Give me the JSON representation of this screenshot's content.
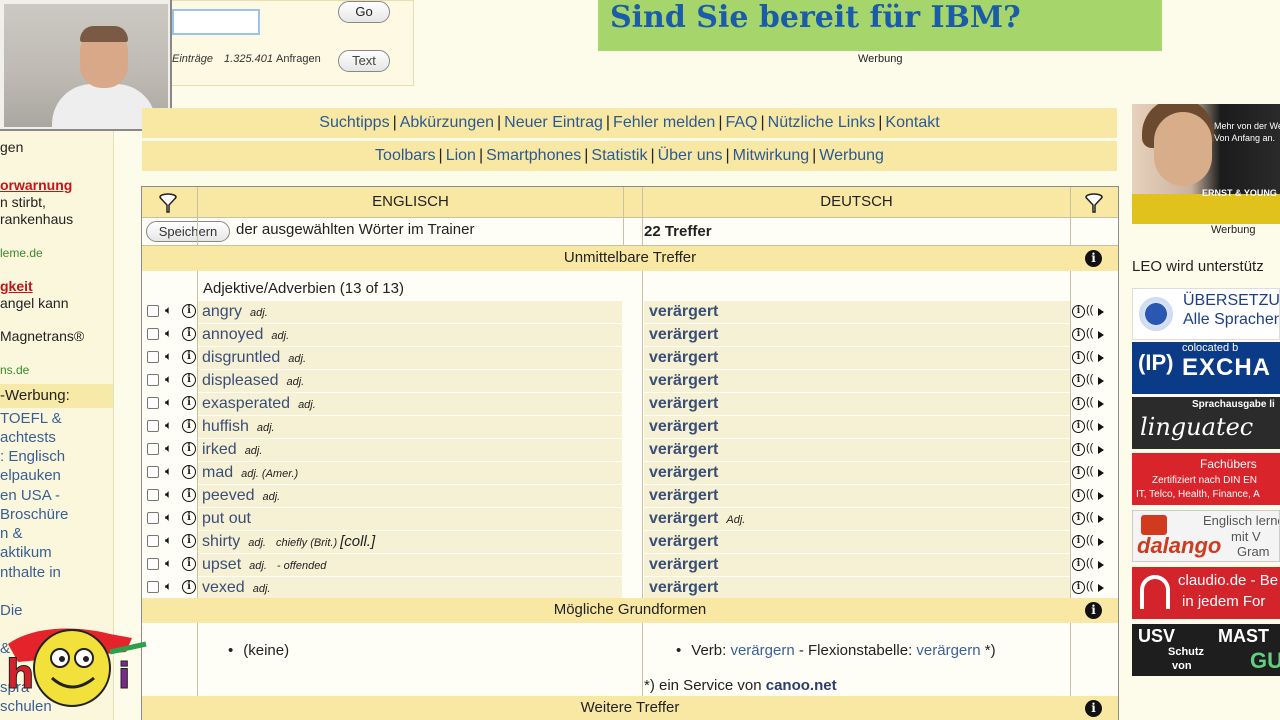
{
  "search": {
    "go_label": "Go",
    "text_label": "Text",
    "entries_prefix": "Einträge",
    "queries_count": "1.325.401",
    "queries_label": "Anfragen"
  },
  "banner": {
    "headline": "Sind Sie bereit für IBM?",
    "werbung": "Werbung"
  },
  "nav": {
    "row1": [
      "Suchtipps",
      "Abkürzungen",
      "Neuer Eintrag",
      "Fehler melden",
      "FAQ",
      "Nützliche Links",
      "Kontakt"
    ],
    "row2": [
      "Toolbars",
      "Lion",
      "Smartphones",
      "Statistik",
      "Über uns",
      "Mitwirkung",
      "Werbung"
    ]
  },
  "left": {
    "items": [
      {
        "text": "gen",
        "style": "plain"
      },
      {
        "text": "orwarnung",
        "style": "red"
      },
      {
        "text": "n stirbt,",
        "style": "plain"
      },
      {
        "text": "rankenhaus",
        "style": "plain"
      },
      {
        "text": "leme.de",
        "style": "green"
      },
      {
        "text": "gkeit",
        "style": "red"
      },
      {
        "text": "angel kann",
        "style": "plain"
      },
      {
        "text": "Magnetrans®",
        "style": "plain"
      },
      {
        "text": "ns.de",
        "style": "green"
      },
      {
        "text": "TOEFL &",
        "style": "blue"
      },
      {
        "text": "achtests",
        "style": "blue"
      },
      {
        "text": ": Englisch",
        "style": "blue"
      },
      {
        "text": "elpauken",
        "style": "blue"
      },
      {
        "text": "en USA -",
        "style": "blue"
      },
      {
        "text": "Broschüre",
        "style": "blue"
      },
      {
        "text": "n &",
        "style": "blue"
      },
      {
        "text": "aktikum",
        "style": "blue"
      },
      {
        "text": "nthalte in",
        "style": "blue"
      },
      {
        "text": "Die",
        "style": "blue"
      },
      {
        "text": "&",
        "style": "blue"
      },
      {
        "text": "spra",
        "style": "blue"
      },
      {
        "text": "schulen",
        "style": "blue"
      }
    ],
    "werbung_heading": "-Werbung:",
    "logo_text": "hotodi"
  },
  "table": {
    "col_en": "ENGLISCH",
    "col_de": "DEUTSCH",
    "save_label": "Speichern",
    "save_suffix": "der ausgewählten Wörter im Trainer",
    "hits": "22 Treffer",
    "section_direct": "Unmittelbare Treffer",
    "subsection": "Adjektive/Adverbien (13 of 13)",
    "rows": [
      {
        "en": "angry",
        "tag": "adj.",
        "de": "verärgert"
      },
      {
        "en": "annoyed",
        "tag": "adj.",
        "de": "verärgert"
      },
      {
        "en": "disgruntled",
        "tag": "adj.",
        "de": "verärgert"
      },
      {
        "en": "displeased",
        "tag": "adj.",
        "de": "verärgert"
      },
      {
        "en": "exasperated",
        "tag": "adj.",
        "de": "verärgert"
      },
      {
        "en": "huffish",
        "tag": "adj.",
        "de": "verärgert"
      },
      {
        "en": "irked",
        "tag": "adj.",
        "de": "verärgert"
      },
      {
        "en": "mad",
        "tag": "adj. (Amer.)",
        "de": "verärgert"
      },
      {
        "en": "peeved",
        "tag": "adj.",
        "de": "verärgert"
      },
      {
        "en": "put out",
        "tag": "",
        "de": "verärgert",
        "de_tag": "Adj."
      },
      {
        "en": "shirty",
        "tag": "adj.",
        "extra": "chiefly (Brit.)",
        "extra2": "[coll.]",
        "de": "verärgert"
      },
      {
        "en": "upset",
        "tag": "adj.",
        "extra": "- offended",
        "de": "verärgert"
      },
      {
        "en": "vexed",
        "tag": "adj.",
        "de": "verärgert"
      }
    ],
    "section_basic": "Mögliche Grundformen",
    "basic_en": "(keine)",
    "basic_de_prefix": "Verb:",
    "basic_de_verb": "verärgern",
    "basic_de_mid": "- Flexionstabelle:",
    "basic_de_link": "verärgern",
    "basic_de_suffix": "*)",
    "canoo_prefix": "*) ein Service von",
    "canoo_link": "canoo.net",
    "section_more": "Weitere Treffer"
  },
  "right": {
    "ey_text1": "Mehr von der We",
    "ey_text2": "Von Anfang an.",
    "ey_brand": "ERNST & YOUNG",
    "ey_werbung": "Werbung",
    "leo_support": "LEO wird unterstütz",
    "ad1_a": "ÜBERSETZU",
    "ad1_b": "Alle Sprachen",
    "ad2_ip": "(IP)",
    "ad2_a": "colocated b",
    "ad2_b": "EXCHA",
    "ad3_a": "Sprachausgabe li",
    "ad3_b": "linguatec",
    "ad4_a": "Fachübers",
    "ad4_b": "Zertifiziert nach DIN EN",
    "ad4_c": "IT, Telco, Health, Finance, A",
    "ad5_a": "Englisch lerne",
    "ad5_b": "dalango",
    "ad5_c": "mit V",
    "ad5_d": "Gram",
    "ad6_a": "claudio.de - Be",
    "ad6_b": "in jedem For",
    "ad7_a": "USV",
    "ad7_b": "MAST",
    "ad7_c": "Schutz",
    "ad7_d": "von",
    "ad7_e": "GU"
  }
}
